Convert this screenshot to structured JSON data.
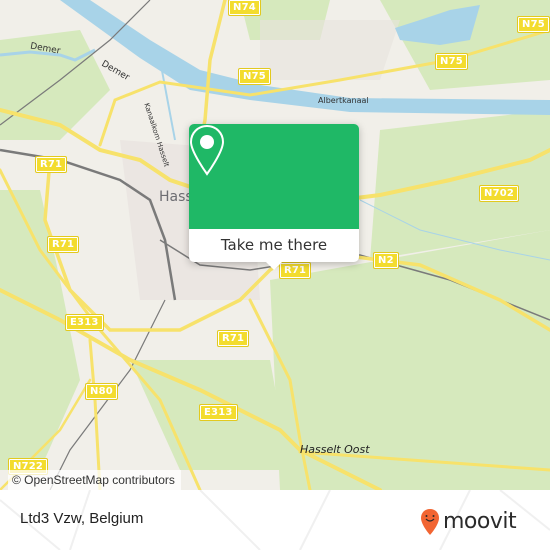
{
  "map": {
    "city_label": "Hasselt",
    "water_labels": [
      "Demer",
      "Demer",
      "Albertkanaal",
      "Kanaalkom Hasselt"
    ],
    "place_labels": [
      "Hasselt Oost"
    ],
    "road_shields": [
      "N74",
      "N75",
      "N75",
      "N75",
      "R71",
      "R71",
      "R71",
      "R71",
      "N702",
      "N2",
      "E313",
      "E313",
      "N80",
      "N722"
    ],
    "attribution": "© OpenStreetMap contributors",
    "colors": {
      "land": "#f1efe9",
      "green": "#d4e8b8",
      "water": "#a8d3e8",
      "road": "#f7e26b",
      "rail": "#777777"
    }
  },
  "popup": {
    "icon": "map-pin-icon",
    "button_label": "Take me there",
    "color": "#1fb866"
  },
  "footer": {
    "location_title": "Ltd3 Vzw, Belgium",
    "brand": "moovit",
    "brand_icon": "moovit-logo-icon",
    "brand_color": "#f26532"
  }
}
